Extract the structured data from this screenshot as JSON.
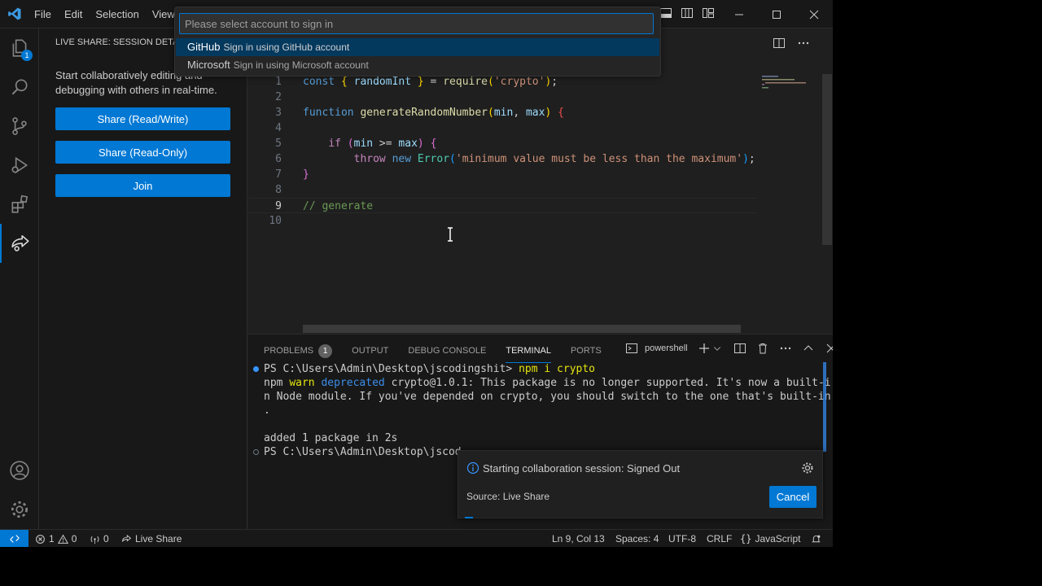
{
  "menu": [
    "File",
    "Edit",
    "Selection",
    "View"
  ],
  "quickpick": {
    "placeholder": "Please select account to sign in",
    "items": [
      {
        "label": "GitHub",
        "description": "Sign in using GitHub account"
      },
      {
        "label": "Microsoft",
        "description": "Sign in using Microsoft account"
      }
    ]
  },
  "activity": {
    "explorer_badge": "1"
  },
  "sidebar": {
    "title": "LIVE SHARE: SESSION DETAILS",
    "description": "Start collaboratively editing and debugging with others in real-time.",
    "buttons": [
      "Share (Read/Write)",
      "Share (Read-Only)",
      "Join"
    ]
  },
  "editor": {
    "line_numbers": [
      "1",
      "2",
      "3",
      "4",
      "5",
      "6",
      "7",
      "8",
      "9",
      "10"
    ],
    "active_line": "9"
  },
  "panel": {
    "tabs": [
      "PROBLEMS",
      "OUTPUT",
      "DEBUG CONSOLE",
      "TERMINAL",
      "PORTS"
    ],
    "problems_count": "1",
    "terminal_profile": "powershell",
    "terminal": {
      "prompt1": "PS C:\\Users\\Admin\\Desktop\\jscodingshit>",
      "cmd1": "npm i crypto",
      "warn_npm": "npm",
      "warn_word": "warn",
      "warn_dep": "deprecated",
      "warn_msg_1": "crypto@1.0.1: This package is no longer supported. It's now a built-i",
      "warn_msg_2": "n Node module. If you've depended on crypto, you should switch to the one that's built-in",
      "warn_msg_3": ".",
      "added": "added 1 package in 2s",
      "prompt2": "PS C:\\Users\\Admin\\Desktop\\jscod"
    }
  },
  "notification": {
    "message": "Starting collaboration session: Signed Out",
    "source": "Source: Live Share",
    "button": "Cancel"
  },
  "statusbar": {
    "errors": "1",
    "warnings": "0",
    "ports": "0",
    "liveshare": "Live Share",
    "position": "Ln 9, Col 13",
    "spaces": "Spaces: 4",
    "encoding": "UTF-8",
    "eol": "CRLF",
    "language": "JavaScript"
  },
  "colors": {
    "accent": "#0078d4",
    "background": "#1f1f1f",
    "sidebar": "#181818"
  }
}
